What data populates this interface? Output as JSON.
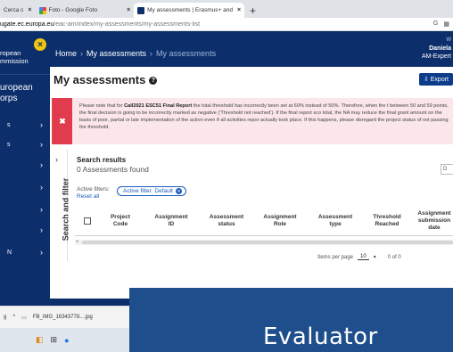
{
  "browser": {
    "tabs": [
      {
        "label": "Cerca c",
        "active": false
      },
      {
        "label": "Foto - Google Foto",
        "active": false
      },
      {
        "label": "My assessments | Erasmus+ and",
        "active": true
      }
    ],
    "new_tab": "+",
    "url_host": "ugate.ec.europa.eu",
    "url_path": "/eac-am/index/my-assessments/my-assessments-list"
  },
  "sidebar": {
    "org_title": "ropean\nmmission",
    "app_title": "uropean\norps",
    "items": [
      {
        "label": "s"
      },
      {
        "label": "s"
      },
      {
        "label": ""
      },
      {
        "label": ""
      },
      {
        "label": ""
      },
      {
        "label": ""
      },
      {
        "label": "N"
      }
    ],
    "badge": "×"
  },
  "header": {
    "breadcrumb": [
      "Home",
      "My assessments",
      "My assessments"
    ],
    "user_welcome": "W",
    "user_name": "Daniela",
    "user_role": "AM-Expert"
  },
  "main": {
    "title": "My assessments",
    "export_label": "Export",
    "alert": {
      "text_before": "Please note that for ",
      "text_bold": "Call2021 ESC51 Final Report",
      "text_after": " the total threshold has incorrectly been set at 60% instead of 50%. Therefore, when the t between 50 and 59 points, the final decision is going to be incorrectly marked as negative ('Threshold not reached'). If the final report sco total, the NA may reduce the final grant amount on the basis of poor, partial or late implementation of the action even if all activities repor actually took place. If this happens, please disregard the project status of not passing the threshold."
    },
    "search_filter_label": "Search and filter",
    "results_title": "Search results",
    "results_count": "0 Assessments found",
    "right_dropdown": "D",
    "active_filters_label": "Active filters:",
    "reset_label": "Reset all",
    "active_filter_chip": "Active filter: Default",
    "columns": [
      "Project\nCode",
      "Assignment\nID",
      "Assessment\nstatus",
      "Assignment\nRole",
      "Assessment\ntype",
      "Threshold\nReached",
      "Assignment\nsubmission\ndate"
    ],
    "pager": {
      "items_per_page_label": "Items per page",
      "items_per_page": "10",
      "range": "0 of 0"
    }
  },
  "downloads": {
    "file_name": "FB_IMG_16343778....jpg"
  },
  "overlay": {
    "text": "Evaluator"
  },
  "colors": {
    "navy": "#0c2f6b",
    "alert_red": "#e03c4e",
    "overlay_blue": "#1f4e8c",
    "link_blue": "#1a5bbf"
  }
}
